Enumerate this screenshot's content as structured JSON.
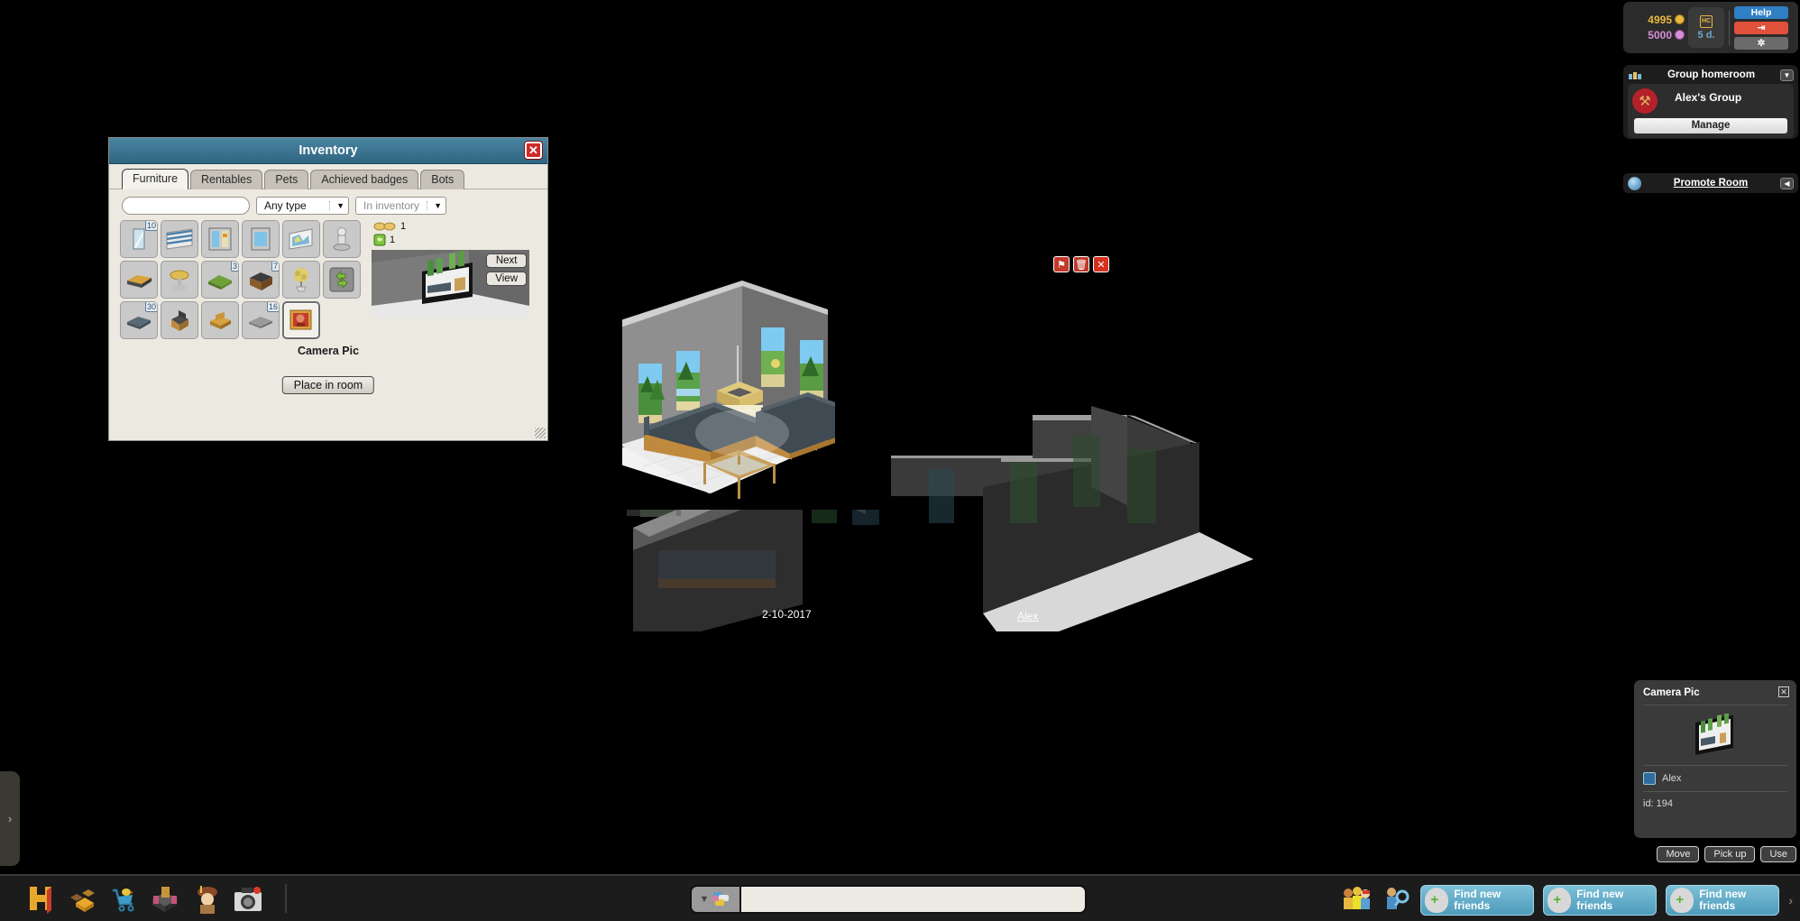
{
  "inventory": {
    "title": "Inventory",
    "close_icon": "close-icon",
    "tabs": [
      {
        "label": "Furniture",
        "active": true
      },
      {
        "label": "Rentables",
        "active": false
      },
      {
        "label": "Pets",
        "active": false
      },
      {
        "label": "Achieved badges",
        "active": false
      },
      {
        "label": "Bots",
        "active": false
      }
    ],
    "search_value": "",
    "search_placeholder": "",
    "type_filter": "Any type",
    "location_filter": "In inventory",
    "items": [
      {
        "name": "mirror",
        "qty": "10"
      },
      {
        "name": "greek-flag",
        "qty": ""
      },
      {
        "name": "window-double",
        "qty": ""
      },
      {
        "name": "window-single",
        "qty": ""
      },
      {
        "name": "projector-screen",
        "qty": ""
      },
      {
        "name": "trophy",
        "qty": ""
      },
      {
        "name": "log-bench",
        "qty": ""
      },
      {
        "name": "gold-stool",
        "qty": ""
      },
      {
        "name": "grass-patch",
        "qty": "3"
      },
      {
        "name": "wooden-chest",
        "qty": "7"
      },
      {
        "name": "topiary-plant",
        "qty": ""
      },
      {
        "name": "recycler",
        "qty": ""
      },
      {
        "name": "pillow-roll",
        "qty": "30"
      },
      {
        "name": "barber-chair",
        "qty": ""
      },
      {
        "name": "wooden-bench",
        "qty": ""
      },
      {
        "name": "stone-tile",
        "qty": "16"
      },
      {
        "name": "camera-pic",
        "qty": "",
        "selected": true
      }
    ],
    "counts": [
      {
        "icon": "handshake-icon",
        "value": "1"
      },
      {
        "icon": "recycle-token-icon",
        "value": "1"
      }
    ],
    "preview_next": "Next",
    "preview_view": "View",
    "selected_item_name": "Camera Pic",
    "place_button": "Place in room"
  },
  "room": {
    "photo_date": "2-10-2017",
    "photo_user": "Alex",
    "badges": [
      {
        "icon": "flag-icon",
        "kind": "flag"
      },
      {
        "icon": "trash-icon",
        "kind": "trash"
      },
      {
        "icon": "close-icon",
        "kind": "x"
      }
    ]
  },
  "topbar": {
    "credits": "4995",
    "duckets": "5000",
    "hc_label": "HC",
    "hc_days": "5 d.",
    "help_label": "Help",
    "exit_icon": "exit-icon",
    "settings_icon": "gear-icon"
  },
  "group": {
    "header_icon": "group-icon",
    "header_title": "Group homeroom",
    "caret_icon": "chevron-down-icon",
    "group_name": "Alex's Group",
    "badge_icon": "bull-badge-icon",
    "manage_label": "Manage"
  },
  "promote": {
    "icon": "globe-icon",
    "label": "Promote Room",
    "caret_icon": "chevron-left-icon"
  },
  "furni_info": {
    "title": "Camera Pic",
    "close_icon": "close-icon",
    "thumb_icon": "camera-pic-thumb",
    "owner_icon": "owner-avatar-icon",
    "owner": "Alex",
    "id_label": "id: 194",
    "buttons": [
      "Move",
      "Pick up",
      "Use"
    ]
  },
  "toolbar": {
    "icons": [
      {
        "name": "habbo-logo-icon"
      },
      {
        "name": "navigator-icon"
      },
      {
        "name": "catalog-cart-icon"
      },
      {
        "name": "inventory-furni-icon"
      },
      {
        "name": "avatar-profile-icon"
      },
      {
        "name": "camera-icon"
      }
    ],
    "chat_style_icon": "chat-bubble-icon",
    "chat_caret_icon": "chevron-down-icon",
    "chat_value": "",
    "chat_placeholder": "",
    "right_icons": [
      {
        "name": "friends-group-icon"
      },
      {
        "name": "friend-search-icon"
      }
    ],
    "friend_buttons": [
      {
        "label": "Find new friends"
      },
      {
        "label": "Find new friends"
      },
      {
        "label": "Find new friends"
      }
    ],
    "next_arrow_icon": "chevron-right-icon",
    "side_tab_icon": "chevron-right-icon"
  }
}
